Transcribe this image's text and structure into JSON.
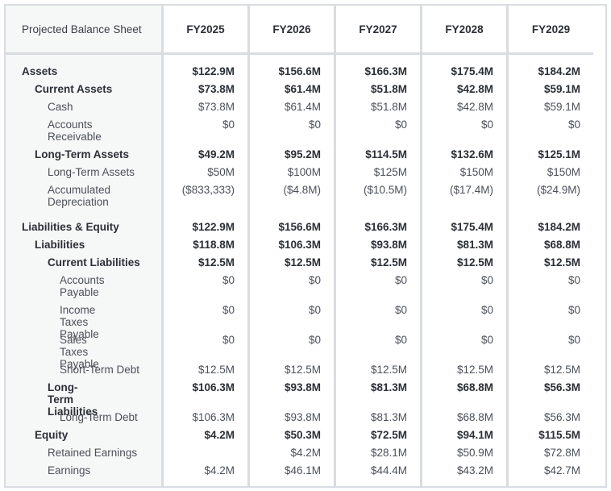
{
  "table": {
    "title": "Projected Balance Sheet",
    "columns": [
      "FY2025",
      "FY2026",
      "FY2027",
      "FY2028",
      "FY2029"
    ],
    "rows": [
      {
        "label": "Assets",
        "level": 0,
        "bold": true,
        "lines": 1,
        "values": [
          "$122.9M",
          "$156.6M",
          "$166.3M",
          "$175.4M",
          "$184.2M"
        ]
      },
      {
        "label": "Current Assets",
        "level": 1,
        "bold": true,
        "lines": 1,
        "values": [
          "$73.8M",
          "$61.4M",
          "$51.8M",
          "$42.8M",
          "$59.1M"
        ]
      },
      {
        "label": "Cash",
        "level": 2,
        "bold": false,
        "lines": 1,
        "values": [
          "$73.8M",
          "$61.4M",
          "$51.8M",
          "$42.8M",
          "$59.1M"
        ]
      },
      {
        "label": "Accounts Receivable",
        "level": 2,
        "bold": false,
        "lines": 2,
        "values": [
          "$0",
          "$0",
          "$0",
          "$0",
          "$0"
        ]
      },
      {
        "label": "Long-Term Assets",
        "level": 1,
        "bold": true,
        "lines": 1,
        "values": [
          "$49.2M",
          "$95.2M",
          "$114.5M",
          "$132.6M",
          "$125.1M"
        ]
      },
      {
        "label": "Long-Term Assets",
        "level": 2,
        "bold": false,
        "lines": 1,
        "values": [
          "$50M",
          "$100M",
          "$125M",
          "$150M",
          "$150M"
        ]
      },
      {
        "label": "Accumulated Depreciation",
        "level": 2,
        "bold": false,
        "lines": 2,
        "values": [
          "($833,333)",
          "($4.8M)",
          "($10.5M)",
          "($17.4M)",
          "($24.9M)"
        ]
      },
      {
        "gap": true
      },
      {
        "label": "Liabilities & Equity",
        "level": 0,
        "bold": true,
        "lines": 1,
        "values": [
          "$122.9M",
          "$156.6M",
          "$166.3M",
          "$175.4M",
          "$184.2M"
        ]
      },
      {
        "label": "Liabilities",
        "level": 1,
        "bold": true,
        "lines": 1,
        "values": [
          "$118.8M",
          "$106.3M",
          "$93.8M",
          "$81.3M",
          "$68.8M"
        ]
      },
      {
        "label": "Current Liabilities",
        "level": 2,
        "bold": true,
        "lines": 1,
        "values": [
          "$12.5M",
          "$12.5M",
          "$12.5M",
          "$12.5M",
          "$12.5M"
        ]
      },
      {
        "label": "Accounts Payable",
        "level": 3,
        "bold": false,
        "lines": 2,
        "values": [
          "$0",
          "$0",
          "$0",
          "$0",
          "$0"
        ]
      },
      {
        "label": "Income Taxes Payable",
        "level": 3,
        "bold": false,
        "lines": 2,
        "values": [
          "$0",
          "$0",
          "$0",
          "$0",
          "$0"
        ]
      },
      {
        "label": "Sales Taxes Payable",
        "level": 3,
        "bold": false,
        "lines": 2,
        "values": [
          "$0",
          "$0",
          "$0",
          "$0",
          "$0"
        ]
      },
      {
        "label": "Short-Term Debt",
        "level": 3,
        "bold": false,
        "lines": 1,
        "values": [
          "$12.5M",
          "$12.5M",
          "$12.5M",
          "$12.5M",
          "$12.5M"
        ]
      },
      {
        "label": "Long-Term Liabilities",
        "level": 2,
        "bold": true,
        "lines": 2,
        "values": [
          "$106.3M",
          "$93.8M",
          "$81.3M",
          "$68.8M",
          "$56.3M"
        ]
      },
      {
        "label": "Long-Term Debt",
        "level": 3,
        "bold": false,
        "lines": 1,
        "values": [
          "$106.3M",
          "$93.8M",
          "$81.3M",
          "$68.8M",
          "$56.3M"
        ]
      },
      {
        "label": "Equity",
        "level": 1,
        "bold": true,
        "lines": 1,
        "values": [
          "$4.2M",
          "$50.3M",
          "$72.5M",
          "$94.1M",
          "$115.5M"
        ]
      },
      {
        "label": "Retained Earnings",
        "level": 2,
        "bold": false,
        "lines": 1,
        "values": [
          "",
          "$4.2M",
          "$28.1M",
          "$50.9M",
          "$72.8M"
        ]
      },
      {
        "label": "Earnings",
        "level": 2,
        "bold": false,
        "lines": 1,
        "values": [
          "$4.2M",
          "$46.1M",
          "$44.4M",
          "$43.2M",
          "$42.7M"
        ]
      }
    ]
  }
}
